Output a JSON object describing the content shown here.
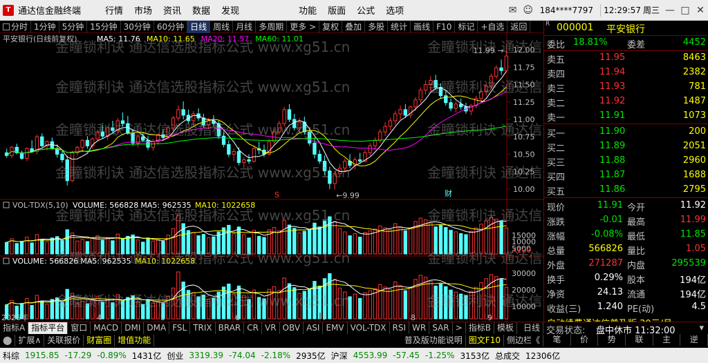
{
  "app": {
    "title": "通达信金融终端",
    "menus": [
      "行情",
      "市场",
      "资讯",
      "数据",
      "发现",
      "功能",
      "版面",
      "公式",
      "选项"
    ],
    "user": "184****7797",
    "time": "12:29:57",
    "weekday": "周三"
  },
  "toolbar": {
    "buttons": [
      "分时",
      "1分钟",
      "5分钟",
      "15分钟",
      "30分钟",
      "60分钟",
      "日线",
      "周线",
      "月线",
      "多周期",
      "更多 >",
      "复权",
      "叠加",
      "多股",
      "统计",
      "画线",
      "F10",
      "标记",
      "+自选",
      "返回"
    ],
    "active": "日线"
  },
  "chart": {
    "title_line": "平安银行(日线前复权)",
    "ma": [
      {
        "label": "MA5: 11.76",
        "color": "#ffffff"
      },
      {
        "label": "MA10: 11.65",
        "color": "#ffff00"
      },
      {
        "label": "MA20: 11.57",
        "color": "#ff00ff"
      },
      {
        "label": "MA60: 11.01",
        "color": "#00ff00"
      }
    ],
    "high_label": "11.99",
    "low_label": "9.99",
    "price_axis": [
      "12.00",
      "11.75",
      "11.50",
      "11.25",
      "11.00",
      "10.75",
      "10.50",
      "10.25",
      "10.00"
    ],
    "vol1_title": "VOL-TDX(5,10)",
    "vol1_values": [
      {
        "label": "VOLUME: 566828",
        "color": "#ffffff"
      },
      {
        "label": "MA5: 962535",
        "color": "#ffffff"
      },
      {
        "label": "MA10: 1022658",
        "color": "#ffff00"
      }
    ],
    "vol1_axis": [
      "15000",
      "10000",
      "5000",
      "X100"
    ],
    "vol2_values": [
      {
        "label": "VOLUME: 566826",
        "color": "#ffffff"
      },
      {
        "label": "MA5: 962535",
        "color": "#ffffff"
      },
      {
        "label": "MA10: 1022658",
        "color": "#ffff00"
      }
    ],
    "vol2_axis": [
      "30000",
      "20000",
      "10000"
    ],
    "x_labels": [
      "2026年",
      "4",
      "5",
      "6",
      "7",
      "8",
      "9"
    ],
    "markers": {
      "s": "S",
      "cai": "财"
    },
    "watermark": "金瞳锁利诀 通达信选股指标公式 www.xg51.cn"
  },
  "quote": {
    "code": "000001",
    "name": "平安银行",
    "weibi_label": "委比",
    "weibi": "18.81%",
    "weicha_label": "委差",
    "weicha": "4452",
    "asks": [
      {
        "label": "卖五",
        "price": "11.95",
        "vol": "8463"
      },
      {
        "label": "卖四",
        "price": "11.94",
        "vol": "2382"
      },
      {
        "label": "卖三",
        "price": "11.93",
        "vol": "781"
      },
      {
        "label": "卖二",
        "price": "11.92",
        "vol": "1487"
      },
      {
        "label": "卖一",
        "price": "11.91",
        "vol": "1073"
      }
    ],
    "bids": [
      {
        "label": "买一",
        "price": "11.90",
        "vol": "200"
      },
      {
        "label": "买二",
        "price": "11.89",
        "vol": "2051"
      },
      {
        "label": "买三",
        "price": "11.88",
        "vol": "2960"
      },
      {
        "label": "买四",
        "price": "11.87",
        "vol": "1688"
      },
      {
        "label": "买五",
        "price": "11.86",
        "vol": "2795"
      }
    ],
    "stats": [
      {
        "l1": "现价",
        "v1": "11.91",
        "c1": "green",
        "l2": "今开",
        "v2": "11.92",
        "c2": "white"
      },
      {
        "l1": "涨跌",
        "v1": "-0.01",
        "c1": "green",
        "l2": "最高",
        "v2": "11.99",
        "c2": "red"
      },
      {
        "l1": "涨幅",
        "v1": "-0.08%",
        "c1": "green",
        "l2": "最低",
        "v2": "11.85",
        "c2": "green"
      },
      {
        "l1": "总量",
        "v1": "566826",
        "c1": "yellow",
        "l2": "量比",
        "v2": "1.05",
        "c2": "red"
      },
      {
        "l1": "外盘",
        "v1": "271287",
        "c1": "red",
        "l2": "内盘",
        "v2": "295539",
        "c2": "green"
      },
      {
        "l1": "换手",
        "v1": "0.29%",
        "c1": "white",
        "l2": "股本",
        "v2": "194亿",
        "c2": "white"
      },
      {
        "l1": "净资",
        "v1": "24.13",
        "c1": "white",
        "l2": "流通",
        "v2": "194亿",
        "c2": "white"
      },
      {
        "l1": "收益(三)",
        "v1": "1.240",
        "c1": "white",
        "l2": "PE(动)",
        "v2": "4.5",
        "c2": "white"
      }
    ],
    "promo": "自动续费通达信普及版 30元/月",
    "trade_status_label": "交易状态:",
    "trade_status": "盘中休市 11:32:00"
  },
  "tabs": {
    "row1": [
      "指标A",
      "指标平台",
      "窗口",
      "MACD",
      "DMI",
      "DMA",
      "FSL",
      "TRIX",
      "BRAR",
      "CR",
      "VR",
      "OBV",
      "ASI",
      "EMV",
      "VOL-TDX",
      "RSI",
      "WR",
      "SAR",
      ">",
      "指标B",
      "模板"
    ],
    "active": "指标平台",
    "row2": [
      "扩展∧",
      "关联报价",
      "财富圈",
      "增值功能"
    ],
    "row2_right": [
      "普及版功能说明",
      "图文F10",
      "侧边栏《"
    ],
    "right_buttons": [
      "笔",
      "价",
      "势",
      "联",
      "主",
      "逆"
    ],
    "day_label": "日线"
  },
  "statusbar": [
    {
      "name": "科综",
      "v": "1915.85",
      "c": "-17.29",
      "p": "-0.89%",
      "a": "1431亿"
    },
    {
      "name": "创业",
      "v": "3319.39",
      "c": "-74.04",
      "p": "-2.18%",
      "a": "2935亿"
    },
    {
      "name": "沪深",
      "v": "4553.99",
      "c": "-57.45",
      "p": "-1.25%",
      "a": "3153亿"
    }
  ],
  "statusbar_extra": {
    "label": "总成交",
    "value": "12306亿"
  },
  "series": {
    "candles": [
      [
        10.52,
        10.58,
        10.45,
        10.48
      ],
      [
        10.48,
        10.62,
        10.44,
        10.6
      ],
      [
        10.6,
        10.65,
        10.5,
        10.52
      ],
      [
        10.52,
        10.55,
        10.42,
        10.44
      ],
      [
        10.44,
        10.6,
        10.4,
        10.58
      ],
      [
        10.58,
        10.7,
        10.52,
        10.54
      ],
      [
        10.54,
        10.78,
        10.5,
        10.75
      ],
      [
        10.75,
        10.8,
        10.6,
        10.62
      ],
      [
        10.62,
        10.7,
        10.55,
        10.68
      ],
      [
        10.68,
        10.74,
        10.56,
        10.58
      ],
      [
        10.58,
        10.64,
        10.45,
        10.5
      ],
      [
        10.5,
        10.55,
        10.38,
        10.42
      ],
      [
        10.42,
        10.48,
        10.05,
        10.12
      ],
      [
        10.12,
        10.55,
        10.1,
        10.52
      ],
      [
        10.52,
        10.62,
        10.48,
        10.6
      ],
      [
        10.6,
        10.72,
        10.55,
        10.7
      ],
      [
        10.7,
        10.76,
        10.58,
        10.62
      ],
      [
        10.62,
        10.74,
        10.58,
        10.72
      ],
      [
        10.72,
        10.85,
        10.68,
        10.82
      ],
      [
        10.82,
        10.92,
        10.72,
        10.76
      ],
      [
        10.76,
        10.9,
        10.7,
        10.88
      ],
      [
        10.88,
        10.98,
        10.8,
        10.84
      ],
      [
        10.84,
        11.02,
        10.8,
        10.98
      ],
      [
        10.98,
        11.1,
        10.9,
        10.94
      ],
      [
        10.94,
        11.05,
        10.78,
        10.8
      ],
      [
        10.8,
        10.86,
        10.62,
        10.66
      ],
      [
        10.66,
        10.78,
        10.6,
        10.75
      ],
      [
        10.75,
        10.82,
        10.68,
        10.7
      ],
      [
        10.7,
        10.76,
        10.56,
        10.6
      ],
      [
        10.6,
        10.72,
        10.55,
        10.68
      ],
      [
        10.68,
        10.8,
        10.64,
        10.78
      ],
      [
        10.78,
        10.86,
        10.7,
        10.74
      ],
      [
        10.74,
        10.9,
        10.72,
        10.88
      ],
      [
        10.88,
        11.05,
        10.84,
        11.02
      ],
      [
        11.02,
        11.2,
        10.98,
        11.14
      ],
      [
        11.14,
        11.26,
        11.0,
        11.06
      ],
      [
        11.06,
        11.14,
        10.94,
        10.98
      ],
      [
        10.98,
        11.12,
        10.9,
        11.08
      ],
      [
        11.08,
        11.16,
        10.98,
        11.02
      ],
      [
        11.02,
        11.08,
        10.88,
        10.92
      ],
      [
        10.92,
        11.02,
        10.86,
        10.98
      ],
      [
        10.98,
        11.06,
        10.9,
        10.94
      ],
      [
        10.94,
        10.98,
        10.72,
        10.76
      ],
      [
        10.76,
        10.82,
        10.6,
        10.64
      ],
      [
        10.64,
        10.7,
        10.46,
        10.5
      ],
      [
        10.5,
        10.58,
        10.4,
        10.54
      ],
      [
        10.54,
        10.6,
        10.34,
        10.38
      ],
      [
        10.38,
        10.46,
        10.3,
        10.42
      ],
      [
        10.42,
        10.5,
        10.36,
        10.4
      ],
      [
        10.4,
        10.62,
        10.38,
        10.58
      ],
      [
        10.58,
        10.68,
        10.5,
        10.56
      ],
      [
        10.56,
        10.64,
        10.46,
        10.5
      ],
      [
        10.5,
        10.72,
        10.48,
        10.68
      ],
      [
        10.68,
        10.86,
        10.64,
        10.82
      ],
      [
        10.82,
        10.98,
        10.78,
        10.94
      ],
      [
        10.94,
        11.18,
        10.9,
        11.14
      ],
      [
        11.14,
        11.22,
        10.96,
        11.0
      ],
      [
        11.0,
        11.08,
        10.84,
        10.88
      ],
      [
        10.88,
        11.02,
        10.8,
        10.96
      ],
      [
        10.96,
        11.04,
        10.78,
        10.82
      ],
      [
        10.82,
        10.88,
        10.62,
        10.66
      ],
      [
        10.66,
        10.74,
        10.44,
        10.5
      ],
      [
        10.5,
        10.56,
        10.36,
        10.4
      ],
      [
        10.4,
        10.48,
        10.2,
        10.26
      ],
      [
        10.26,
        10.32,
        10.0,
        10.08
      ],
      [
        10.08,
        10.26,
        9.99,
        10.22
      ],
      [
        10.22,
        10.36,
        10.18,
        10.3
      ],
      [
        10.3,
        10.44,
        10.24,
        10.4
      ],
      [
        10.4,
        10.5,
        10.3,
        10.34
      ],
      [
        10.34,
        10.46,
        10.28,
        10.42
      ],
      [
        10.42,
        10.52,
        10.36,
        10.4
      ],
      [
        10.4,
        10.56,
        10.38,
        10.52
      ],
      [
        10.52,
        10.66,
        10.48,
        10.62
      ],
      [
        10.62,
        10.74,
        10.56,
        10.7
      ],
      [
        10.7,
        10.86,
        10.66,
        10.82
      ],
      [
        10.82,
        10.96,
        10.76,
        10.9
      ],
      [
        10.9,
        11.02,
        10.84,
        10.98
      ],
      [
        10.98,
        11.12,
        10.92,
        11.08
      ],
      [
        11.08,
        11.2,
        11.0,
        11.14
      ],
      [
        11.14,
        11.22,
        11.02,
        11.06
      ],
      [
        11.06,
        11.2,
        11.02,
        11.18
      ],
      [
        11.18,
        11.32,
        11.12,
        11.28
      ],
      [
        11.28,
        11.46,
        11.24,
        11.42
      ],
      [
        11.42,
        11.56,
        11.36,
        11.5
      ],
      [
        11.5,
        11.62,
        11.4,
        11.56
      ],
      [
        11.56,
        11.64,
        11.42,
        11.46
      ],
      [
        11.46,
        11.52,
        11.3,
        11.34
      ],
      [
        11.34,
        11.42,
        11.2,
        11.24
      ],
      [
        11.24,
        11.3,
        11.12,
        11.16
      ],
      [
        11.16,
        11.26,
        11.1,
        11.22
      ],
      [
        11.22,
        11.3,
        11.14,
        11.18
      ],
      [
        11.18,
        11.24,
        11.08,
        11.12
      ],
      [
        11.12,
        11.22,
        11.06,
        11.2
      ],
      [
        11.2,
        11.34,
        11.16,
        11.3
      ],
      [
        11.3,
        11.44,
        11.26,
        11.4
      ],
      [
        11.4,
        11.52,
        11.34,
        11.48
      ],
      [
        11.48,
        11.66,
        11.44,
        11.62
      ],
      [
        11.62,
        11.78,
        11.58,
        11.74
      ],
      [
        11.74,
        11.86,
        11.64,
        11.7
      ],
      [
        11.7,
        11.99,
        11.68,
        11.91
      ]
    ],
    "volumes": [
      42,
      55,
      38,
      46,
      61,
      40,
      70,
      52,
      44,
      58,
      63,
      49,
      88,
      76,
      47,
      53,
      45,
      60,
      66,
      50,
      57,
      48,
      72,
      55,
      64,
      69,
      51,
      43,
      58,
      47,
      52,
      46,
      68,
      92,
      140,
      110,
      85,
      78,
      66,
      71,
      59,
      62,
      80,
      95,
      104,
      74,
      98,
      70,
      58,
      86,
      64,
      60,
      88,
      96,
      84,
      122,
      105,
      93,
      76,
      82,
      90,
      112,
      98,
      120,
      135,
      118,
      92,
      80,
      66,
      74,
      61,
      78,
      84,
      90,
      102,
      95,
      88,
      110,
      96,
      84,
      92,
      118,
      130,
      124,
      112,
      98,
      104,
      96,
      86,
      80,
      74,
      70,
      82,
      94,
      108,
      120,
      132,
      126,
      118,
      94
    ]
  }
}
